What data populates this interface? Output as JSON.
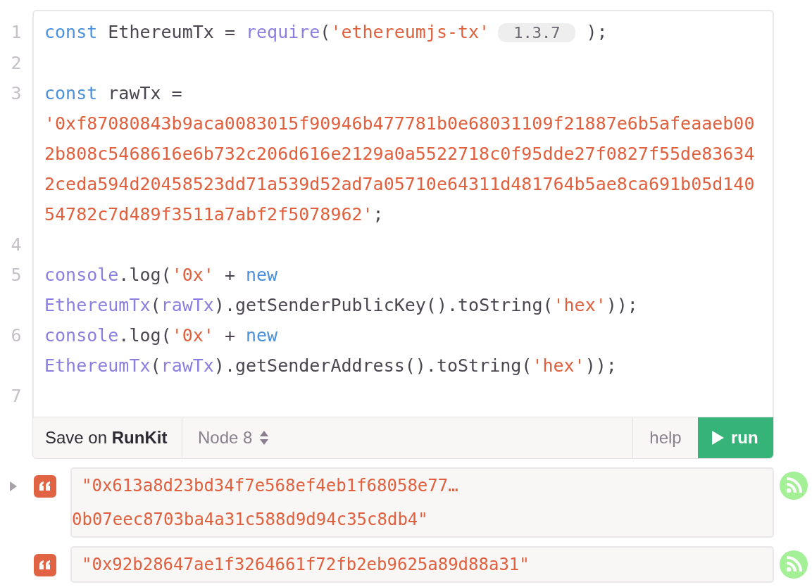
{
  "code": {
    "lines": [
      {
        "number": "1",
        "rows": [
          {
            "tokens": [
              {
                "kind": "keyword",
                "text": "const"
              },
              {
                "kind": "plain",
                "text": " EthereumTx = "
              },
              {
                "kind": "call",
                "text": "require"
              },
              {
                "kind": "plain",
                "text": "("
              },
              {
                "kind": "string",
                "text": "'ethereumjs-tx'"
              },
              {
                "kind": "version",
                "text": "1.3.7"
              },
              {
                "kind": "plain",
                "text": " );"
              }
            ]
          }
        ]
      },
      {
        "number": "2",
        "rows": [
          {
            "tokens": []
          }
        ]
      },
      {
        "number": "3",
        "rows": [
          {
            "tokens": [
              {
                "kind": "keyword",
                "text": "const"
              },
              {
                "kind": "plain",
                "text": " rawTx ="
              }
            ]
          },
          {
            "tokens": [
              {
                "kind": "string",
                "text": "'0xf87080843b9aca0083015f90946b477781b0e68031109f21887e6b5afeaaeb00"
              }
            ]
          },
          {
            "tokens": [
              {
                "kind": "string",
                "text": "2b808c5468616e6b732c206d616e2129a0a5522718c0f95dde27f0827f55de83634"
              }
            ]
          },
          {
            "tokens": [
              {
                "kind": "string",
                "text": "2ceda594d20458523dd71a539d52ad7a05710e64311d481764b5ae8ca691b05d140"
              }
            ]
          },
          {
            "tokens": [
              {
                "kind": "string",
                "text": "54782c7d489f3511a7abf2f5078962'"
              },
              {
                "kind": "plain",
                "text": ";"
              }
            ]
          }
        ]
      },
      {
        "number": "4",
        "rows": [
          {
            "tokens": []
          }
        ]
      },
      {
        "number": "5",
        "rows": [
          {
            "tokens": [
              {
                "kind": "call",
                "text": "console"
              },
              {
                "kind": "plain",
                "text": ".log("
              },
              {
                "kind": "string",
                "text": "'0x'"
              },
              {
                "kind": "plain",
                "text": " + "
              },
              {
                "kind": "keyword",
                "text": "new"
              }
            ]
          },
          {
            "tokens": [
              {
                "kind": "call",
                "text": "EthereumTx"
              },
              {
                "kind": "plain",
                "text": "("
              },
              {
                "kind": "call",
                "text": "rawTx"
              },
              {
                "kind": "plain",
                "text": ").getSenderPublicKey().toString("
              },
              {
                "kind": "string",
                "text": "'hex'"
              },
              {
                "kind": "plain",
                "text": "));"
              }
            ]
          }
        ]
      },
      {
        "number": "6",
        "rows": [
          {
            "tokens": [
              {
                "kind": "call",
                "text": "console"
              },
              {
                "kind": "plain",
                "text": ".log("
              },
              {
                "kind": "string",
                "text": "'0x'"
              },
              {
                "kind": "plain",
                "text": " + "
              },
              {
                "kind": "keyword",
                "text": "new"
              }
            ]
          },
          {
            "tokens": [
              {
                "kind": "call",
                "text": "EthereumTx"
              },
              {
                "kind": "plain",
                "text": "("
              },
              {
                "kind": "call",
                "text": "rawTx"
              },
              {
                "kind": "plain",
                "text": ").getSenderAddress().toString("
              },
              {
                "kind": "string",
                "text": "'hex'"
              },
              {
                "kind": "plain",
                "text": "));"
              }
            ]
          }
        ]
      },
      {
        "number": "7",
        "rows": [
          {
            "tokens": []
          }
        ]
      }
    ]
  },
  "toolbar": {
    "save_prefix": "Save on",
    "save_brand": "RunKit",
    "runtime": "Node 8",
    "help": "help",
    "run": "run"
  },
  "outputs": [
    {
      "expandable": true,
      "lines": [
        "\"0x613a8d23bd34f7e568ef4eb1f68058e77…",
        "0b07eec8703ba4a31c588d9d94c35c8db4\""
      ]
    },
    {
      "expandable": false,
      "lines": [
        "\"0x92b28647ae1f3264661f72fb2eb9625a89d88a31\""
      ]
    }
  ]
}
